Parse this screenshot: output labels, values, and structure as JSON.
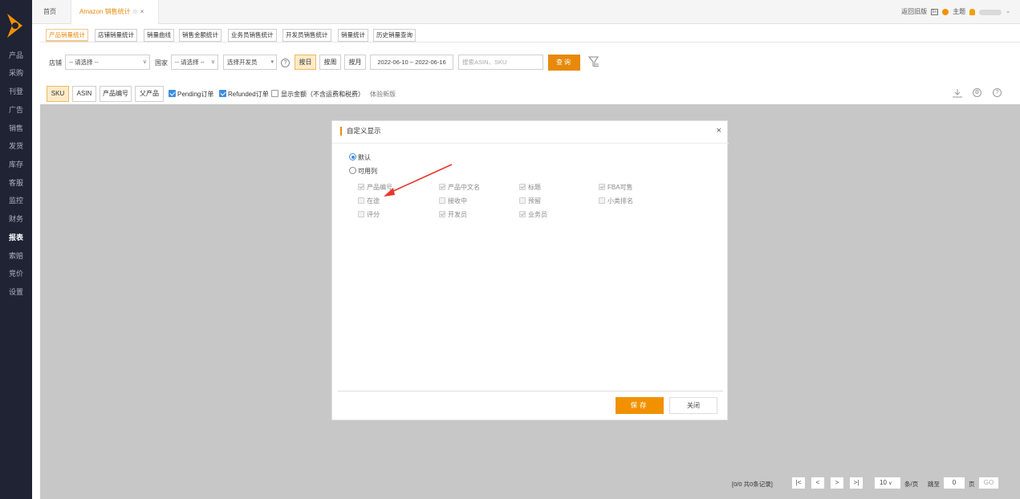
{
  "sidebar": {
    "items": [
      "产品",
      "采购",
      "刊登",
      "广告",
      "销售",
      "发货",
      "库存",
      "客服",
      "监控",
      "财务",
      "报表",
      "索赔",
      "竞价",
      "设置"
    ],
    "active_index": 10
  },
  "tabs": {
    "home": "首页",
    "active": "Amazon 销售统计",
    "star": "☆",
    "close": "×"
  },
  "topright": {
    "back_old": "返回旧版",
    "theme": "主题"
  },
  "subtabs": [
    "产品销量统计",
    "店铺销量统计",
    "销量曲线",
    "销售金额统计",
    "业务员销售统计",
    "开发员销售统计",
    "销量统计",
    "历史销量查询"
  ],
  "filters": {
    "shop_label": "店铺",
    "shop_value": "-- 请选择 --",
    "country_label": "国家",
    "country_value": "-- 请选择 --",
    "developer_value": "选择开发员",
    "by_day": "按日",
    "by_week": "按周",
    "by_month": "按月",
    "date_range": "2022-06-10 ~ 2022-06-16",
    "search_placeholder": "搜索ASIN、SKU",
    "query_button": "查询",
    "help": "?"
  },
  "toolbar": {
    "sku": "SKU",
    "asin": "ASIN",
    "product_no": "产品编号",
    "parent": "父产品",
    "pending": "Pending订单",
    "refunded": "Refunded订单",
    "show_amount": "显示金额（不含运费和税费）",
    "new_version": "体验新版"
  },
  "modal": {
    "title": "自定义显示",
    "close": "×",
    "radio_default": "默认",
    "radio_available": "可用列",
    "columns": [
      {
        "label": "产品编号",
        "checked": true
      },
      {
        "label": "产品中文名",
        "checked": true
      },
      {
        "label": "标题",
        "checked": true
      },
      {
        "label": "FBA可售",
        "checked": true
      },
      {
        "label": "在途",
        "checked": false
      },
      {
        "label": "接收中",
        "checked": false
      },
      {
        "label": "预留",
        "checked": false
      },
      {
        "label": "小类排名",
        "checked": false
      },
      {
        "label": "评分",
        "checked": false
      },
      {
        "label": "开发员",
        "checked": true
      },
      {
        "label": "业务员",
        "checked": true
      }
    ],
    "save": "保存",
    "close_button": "关闭"
  },
  "pagination": {
    "summary": "[0/0  共0条记录]",
    "first": "|<",
    "prev": "<",
    "next": ">",
    "last": ">|",
    "page_size": "10",
    "per_page": "条/页",
    "goto_label": "跳至",
    "page_input": "0",
    "page_unit": "页",
    "go": "GO"
  },
  "colors": {
    "accent": "#e8890c",
    "sidebar": "#1f2333",
    "arrow": "#e8362b"
  }
}
